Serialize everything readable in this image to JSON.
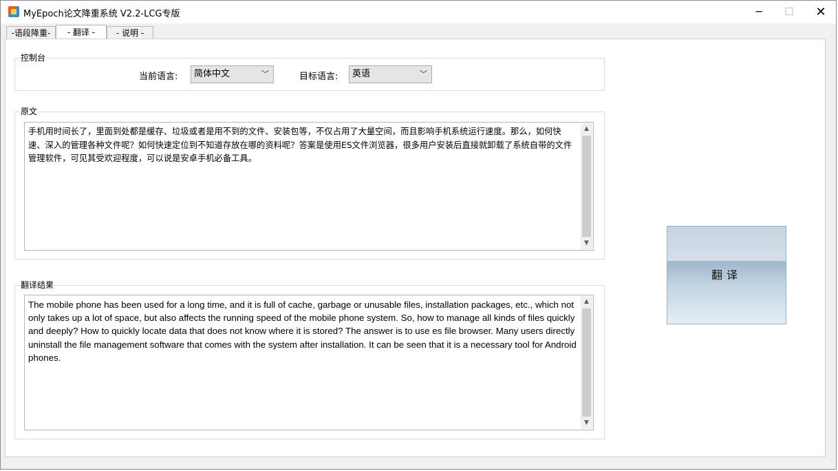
{
  "window": {
    "title": "MyEpoch论文降重系统 V2.2-LCG专版",
    "minimize": "─",
    "maximize": "☐",
    "close": "✕"
  },
  "tabs": [
    {
      "label": "-语段降重-"
    },
    {
      "label": "-  翻译  -"
    },
    {
      "label": "-  说明  -"
    }
  ],
  "control": {
    "group_label": "控制台",
    "source_lang_label": "当前语言:",
    "source_lang_value": "简体中文",
    "target_lang_label": "目标语言:",
    "target_lang_value": "英语"
  },
  "source": {
    "group_label": "原文",
    "text": "手机用时间长了，里面到处都是缓存、垃圾或者是用不到的文件、安装包等，不仅占用了大量空间，而且影响手机系统运行速度。那么，如何快速、深入的管理各种文件呢？如何快速定位到不知道存放在哪的资料呢？答案是使用ES文件浏览器，很多用户安装后直接就卸载了系统自带的文件管理软件，可见其受欢迎程度，可以说是安卓手机必备工具。"
  },
  "result": {
    "group_label": "翻译结果",
    "text": "The mobile phone has been used for a long time, and it is full of cache, garbage or unusable files, installation packages, etc., which not only takes up a lot of space, but also affects the running speed of the mobile phone system. So, how to manage all kinds of files quickly and deeply? How to quickly locate data that does not know where it is stored? The answer is to use es file browser. Many users directly uninstall the file management software that comes with the system after installation. It can be seen that it is a necessary tool for Android phones."
  },
  "translate_button": {
    "label": "翻译"
  },
  "icons": {
    "scroll_up": "▲",
    "scroll_down": "▼",
    "dropdown": "﹀"
  }
}
